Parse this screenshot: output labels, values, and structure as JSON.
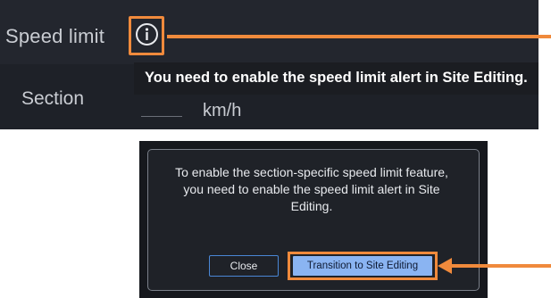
{
  "speed_panel": {
    "speed_limit_label": "Speed limit",
    "section_label": "Section",
    "tooltip_text": "You need to enable the speed limit alert in Site Editing.",
    "input_value": "",
    "unit_label": "km/h"
  },
  "dialog": {
    "message": "To enable the section-specific speed limit feature, you need to enable the speed limit alert in Site Editing.",
    "close_label": "Close",
    "transition_label": "Transition to Site Editing"
  },
  "icons": {
    "info": "info-icon",
    "arrow": "arrow-left-icon"
  },
  "colors": {
    "highlight": "#f08a3c",
    "panel_bg": "#23262e",
    "dialog_bg": "#1f2228",
    "primary_button": "#8ab4f2",
    "secondary_border": "#4a87d6"
  }
}
